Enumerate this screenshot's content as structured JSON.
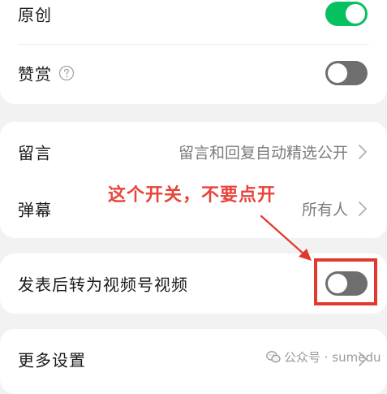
{
  "settings": {
    "original": {
      "label": "原创",
      "toggle_on": true
    },
    "reward": {
      "label": "赞赏",
      "help_icon": "question-circle-icon",
      "toggle_on": false
    },
    "comments": {
      "label": "留言",
      "value": "留言和回复自动精选公开"
    },
    "danmaku": {
      "label": "弹幕",
      "value": "所有人"
    },
    "to_channels": {
      "label": "发表后转为视频号视频",
      "toggle_on": false
    },
    "more": {
      "label": "更多设置"
    }
  },
  "annotation": {
    "text": "这个开关，不要点开",
    "color": "#e8443a"
  },
  "watermark": {
    "text": "公众号 · sumedu",
    "icon": "wechat-icon"
  },
  "colors": {
    "toggle_on": "#07c160",
    "toggle_off": "#6e6e6e",
    "background": "#f2f2f2",
    "card": "#ffffff",
    "annotation_red": "#e03a2f"
  }
}
